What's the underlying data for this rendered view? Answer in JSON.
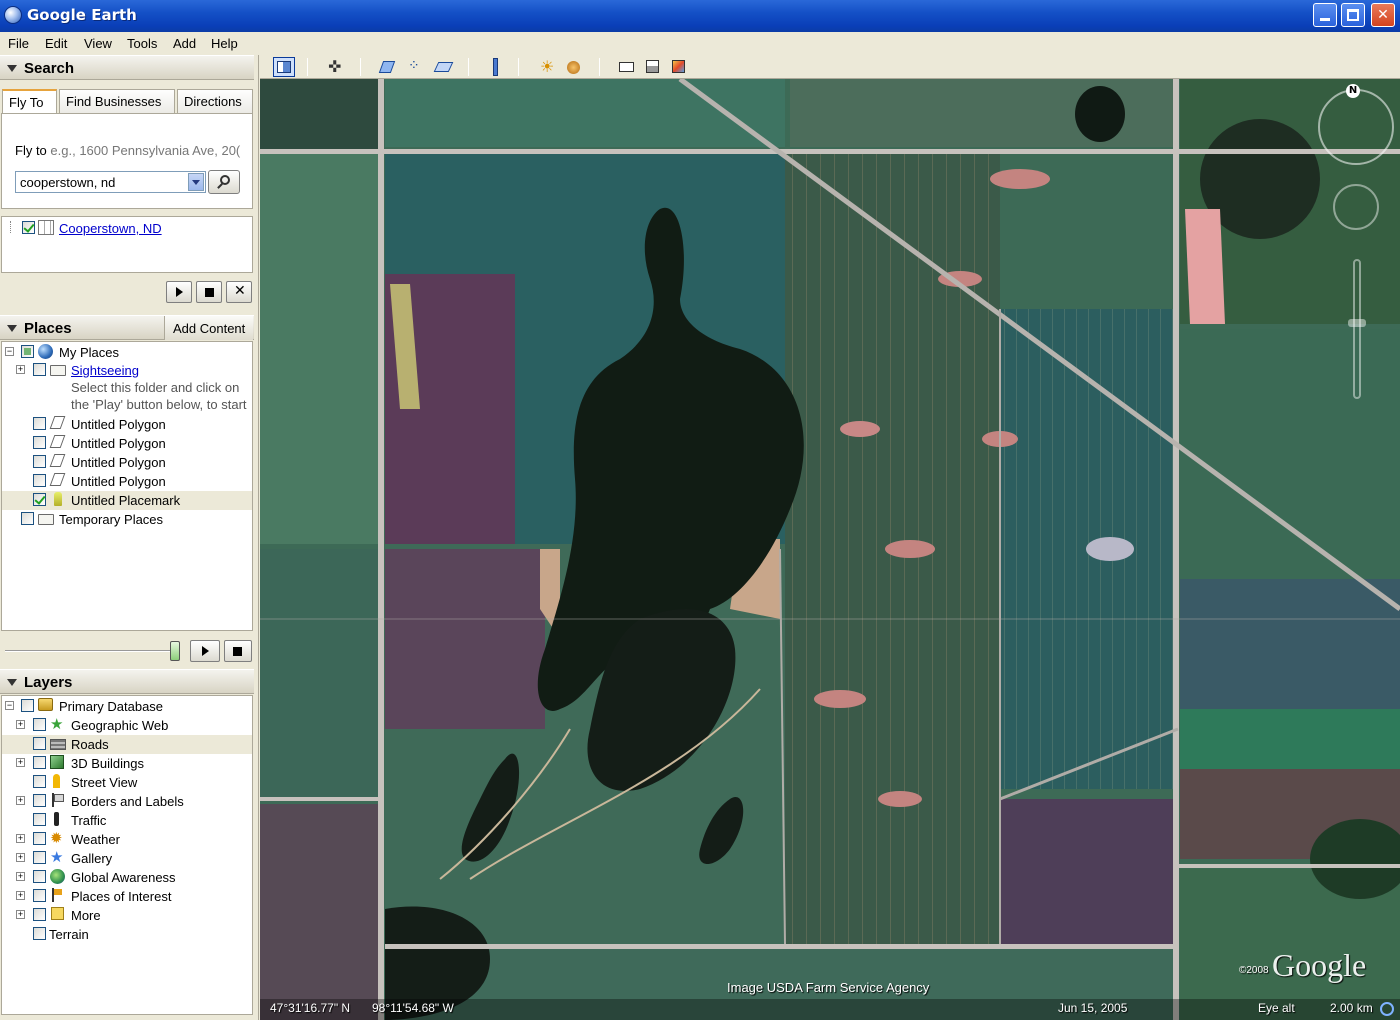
{
  "window": {
    "title": "Google Earth"
  },
  "menu": [
    "File",
    "Edit",
    "View",
    "Tools",
    "Add",
    "Help"
  ],
  "search": {
    "header": "Search",
    "tabs": [
      "Fly To",
      "Find Businesses",
      "Directions"
    ],
    "flyto_label": "Fly to",
    "flyto_hint": "e.g., 1600 Pennsylvania Ave, 20(",
    "input_value": "cooperstown, nd",
    "result": "Cooperstown, ND"
  },
  "places": {
    "header": "Places",
    "add_content": "Add Content",
    "items": [
      {
        "label": "My Places"
      },
      {
        "label": "Sightseeing",
        "desc1": "Select this folder and click on",
        "desc2": "the 'Play' button below, to start"
      },
      {
        "label": "Untitled Polygon"
      },
      {
        "label": "Untitled Polygon"
      },
      {
        "label": "Untitled Polygon"
      },
      {
        "label": "Untitled Polygon"
      },
      {
        "label": "Untitled Placemark"
      },
      {
        "label": "Temporary Places"
      }
    ]
  },
  "layers": {
    "header": "Layers",
    "items": [
      {
        "label": "Primary Database"
      },
      {
        "label": "Geographic Web"
      },
      {
        "label": "Roads"
      },
      {
        "label": "3D Buildings"
      },
      {
        "label": "Street View"
      },
      {
        "label": "Borders and Labels"
      },
      {
        "label": "Traffic"
      },
      {
        "label": "Weather"
      },
      {
        "label": "Gallery"
      },
      {
        "label": "Global Awareness"
      },
      {
        "label": "Places of Interest"
      },
      {
        "label": "More"
      },
      {
        "label": "Terrain"
      }
    ]
  },
  "map": {
    "attribution": "Image USDA Farm Service Agency",
    "lat": "47°31'16.77\" N",
    "lon": "98°11'54.68\" W",
    "date": "Jun 15, 2005",
    "eye_alt_label": "Eye alt",
    "eye_alt_value": "2.00 km",
    "logo": "Google",
    "copyright": "©2008",
    "north": "N"
  }
}
